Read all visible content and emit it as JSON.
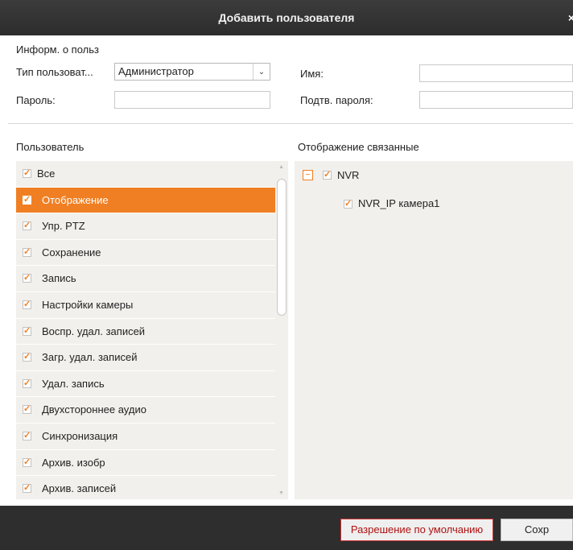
{
  "dialog": {
    "title": "Добавить пользователя",
    "close_glyph": "×"
  },
  "user_info": {
    "section_label": "Информ. о польз",
    "type_label": "Тип пользоват...",
    "type_value": "Администратор",
    "name_label": "Имя:",
    "password_label": "Пароль:",
    "confirm_label": "Подтв. пароля:"
  },
  "permissions": {
    "header": "Пользователь",
    "items": [
      {
        "label": "Все",
        "checked": true
      },
      {
        "label": "Отображение",
        "checked": true,
        "selected": true
      },
      {
        "label": "Упр. PTZ",
        "checked": true
      },
      {
        "label": "Сохранение",
        "checked": true
      },
      {
        "label": "Запись",
        "checked": true
      },
      {
        "label": "Настройки камеры",
        "checked": true
      },
      {
        "label": "Воспр. удал. записей",
        "checked": true
      },
      {
        "label": "Загр. удал. записей",
        "checked": true
      },
      {
        "label": "Удал. запись",
        "checked": true
      },
      {
        "label": "Двухстороннее аудио",
        "checked": true
      },
      {
        "label": "Синхронизация",
        "checked": true
      },
      {
        "label": "Архив. изобр",
        "checked": true
      },
      {
        "label": "Архив. записей",
        "checked": true
      }
    ]
  },
  "resources": {
    "header": "Отображение связанные",
    "root": {
      "label": "NVR",
      "checked": true,
      "expanded": true
    },
    "children": [
      {
        "label": "NVR_IP камера1",
        "checked": true
      }
    ]
  },
  "footer": {
    "default_button": "Разрешение по умолчанию",
    "save_button": "Сохр"
  },
  "colors": {
    "accent": "#f07f23",
    "titlebar": "#333333",
    "panel": "#f1f0ec"
  }
}
